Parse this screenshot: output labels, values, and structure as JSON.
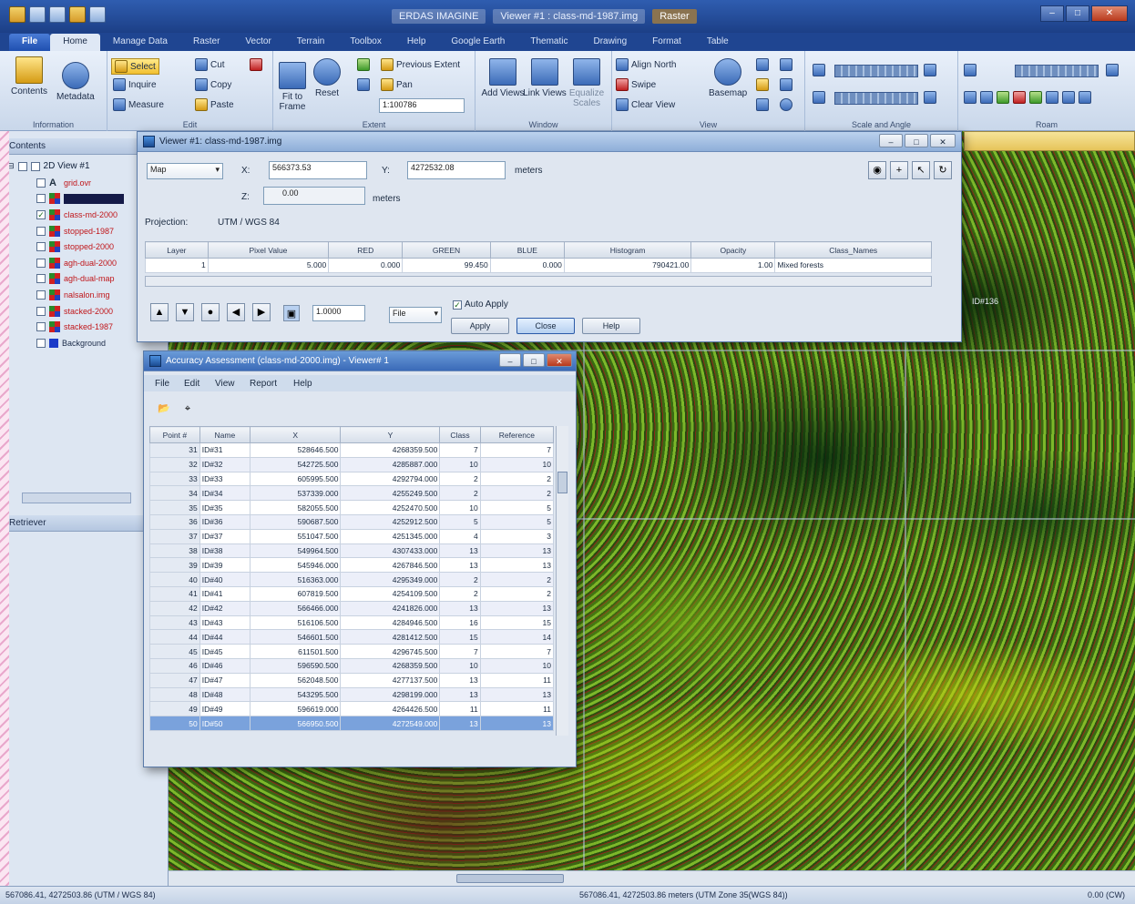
{
  "app": {
    "title": "ERDAS IMAGINE",
    "title_pieces": [
      "Viewer #1 : class-md-1987.img",
      "Raster"
    ],
    "window_buttons": [
      "–",
      "□",
      "✕"
    ]
  },
  "ribbon_tabs": {
    "file": "File",
    "tabs": [
      "Home",
      "Manage Data",
      "Raster",
      "Vector",
      "Terrain",
      "Toolbox",
      "Help",
      "Google Earth",
      "Thematic",
      "Drawing",
      "Format",
      "Table"
    ],
    "active": "Home"
  },
  "ribbon": {
    "information": {
      "label": "Information",
      "contents": "Contents",
      "metadata": "Metadata"
    },
    "edit": {
      "label": "Edit",
      "select": "Select",
      "inquire": "Inquire",
      "measure": "Measure",
      "cut": "Cut",
      "copy": "Copy",
      "paste": "Paste"
    },
    "extent": {
      "label": "Extent",
      "fit_to_frame": "Fit to Frame",
      "reset": "Reset",
      "previous_extent": "Previous Extent",
      "pan": "Pan",
      "scale": "1:100786"
    },
    "window": {
      "label": "Window",
      "add_views": "Add Views",
      "link_views": "Link Views",
      "equalize_scales": "Equalize Scales"
    },
    "view": {
      "label": "View",
      "align_north": "Align North",
      "swipe": "Swipe",
      "clear_view": "Clear View",
      "basemap": "Basemap"
    },
    "scale_angle": {
      "label": "Scale and Angle"
    },
    "roam": {
      "label": "Roam"
    }
  },
  "contents_panel": {
    "title": "Contents",
    "view_name": "2D View #1",
    "retriever": "Retriever",
    "layers": [
      {
        "name": "grid.ovr",
        "checked": false
      },
      {
        "name": "",
        "checked": false
      },
      {
        "name": "class-md-2000",
        "checked": true
      },
      {
        "name": "stopped-1987",
        "checked": false
      },
      {
        "name": "stopped-2000",
        "checked": false
      },
      {
        "name": "agh-dual-2000",
        "checked": false
      },
      {
        "name": "agh-dual-map",
        "checked": false
      },
      {
        "name": "nalsalon.img",
        "checked": false
      },
      {
        "name": "stacked-2000",
        "checked": false
      },
      {
        "name": "stacked-1987",
        "checked": false
      },
      {
        "name": "Background",
        "checked": false
      }
    ]
  },
  "viewer_dialog": {
    "title": "Viewer #1:  class-md-1987.img",
    "mode": "Map",
    "x_label": "X:",
    "x_value": "566373.53",
    "y_label": "Y:",
    "y_value": "4272532.08",
    "units": "meters",
    "z_label": "Z:",
    "z_value": "0.00",
    "z_units": "meters",
    "projection_label": "Projection:",
    "projection_value": "UTM / WGS 84",
    "columns": [
      "Layer",
      "Pixel Value",
      "RED",
      "GREEN",
      "BLUE",
      "Histogram",
      "Opacity",
      "Class_Names"
    ],
    "row": [
      "1",
      "5.000",
      "0.000",
      "99.450",
      "0.000",
      "790421.00",
      "1.00",
      "Mixed forests"
    ],
    "step": "1.0000",
    "file_option": "File",
    "auto_apply": "Auto Apply",
    "apply": "Apply",
    "close": "Close",
    "help": "Help"
  },
  "accuracy_dialog": {
    "title": "Accuracy Assessment (class-md-2000.img) - Viewer# 1",
    "menu": [
      "File",
      "Edit",
      "View",
      "Report",
      "Help"
    ],
    "columns": [
      "Point #",
      "Name",
      "X",
      "Y",
      "Class",
      "Reference"
    ],
    "rows": [
      [
        "31",
        "ID#31",
        "528646.500",
        "4268359.500",
        "7",
        "7"
      ],
      [
        "32",
        "ID#32",
        "542725.500",
        "4285887.000",
        "10",
        "10"
      ],
      [
        "33",
        "ID#33",
        "605995.500",
        "4292794.000",
        "2",
        "2"
      ],
      [
        "34",
        "ID#34",
        "537339.000",
        "4255249.500",
        "2",
        "2"
      ],
      [
        "35",
        "ID#35",
        "582055.500",
        "4252470.500",
        "10",
        "5"
      ],
      [
        "36",
        "ID#36",
        "590687.500",
        "4252912.500",
        "5",
        "5"
      ],
      [
        "37",
        "ID#37",
        "551047.500",
        "4251345.000",
        "4",
        "3"
      ],
      [
        "38",
        "ID#38",
        "549964.500",
        "4307433.000",
        "13",
        "13"
      ],
      [
        "39",
        "ID#39",
        "545946.000",
        "4267846.500",
        "13",
        "13"
      ],
      [
        "40",
        "ID#40",
        "516363.000",
        "4295349.000",
        "2",
        "2"
      ],
      [
        "41",
        "ID#41",
        "607819.500",
        "4254109.500",
        "2",
        "2"
      ],
      [
        "42",
        "ID#42",
        "566466.000",
        "4241826.000",
        "13",
        "13"
      ],
      [
        "43",
        "ID#43",
        "516106.500",
        "4284946.500",
        "16",
        "15"
      ],
      [
        "44",
        "ID#44",
        "546601.500",
        "4281412.500",
        "15",
        "14"
      ],
      [
        "45",
        "ID#45",
        "611501.500",
        "4296745.500",
        "7",
        "7"
      ],
      [
        "46",
        "ID#46",
        "596590.500",
        "4268359.500",
        "10",
        "10"
      ],
      [
        "47",
        "ID#47",
        "562048.500",
        "4277137.500",
        "13",
        "11"
      ],
      [
        "48",
        "ID#48",
        "543295.500",
        "4298199.000",
        "13",
        "13"
      ],
      [
        "49",
        "ID#49",
        "596619.000",
        "4264426.500",
        "11",
        "11"
      ],
      [
        "50",
        "ID#50",
        "566950.500",
        "4272549.000",
        "13",
        "13"
      ]
    ],
    "selected_row": "50"
  },
  "status_bar": {
    "left": "567086.41, 4272503.86  (UTM / WGS 84)",
    "center": "567086.41, 4272503.86 meters (UTM Zone 35(WGS 84))",
    "right": "0.00 (CW)"
  },
  "map_label": "ID#136"
}
